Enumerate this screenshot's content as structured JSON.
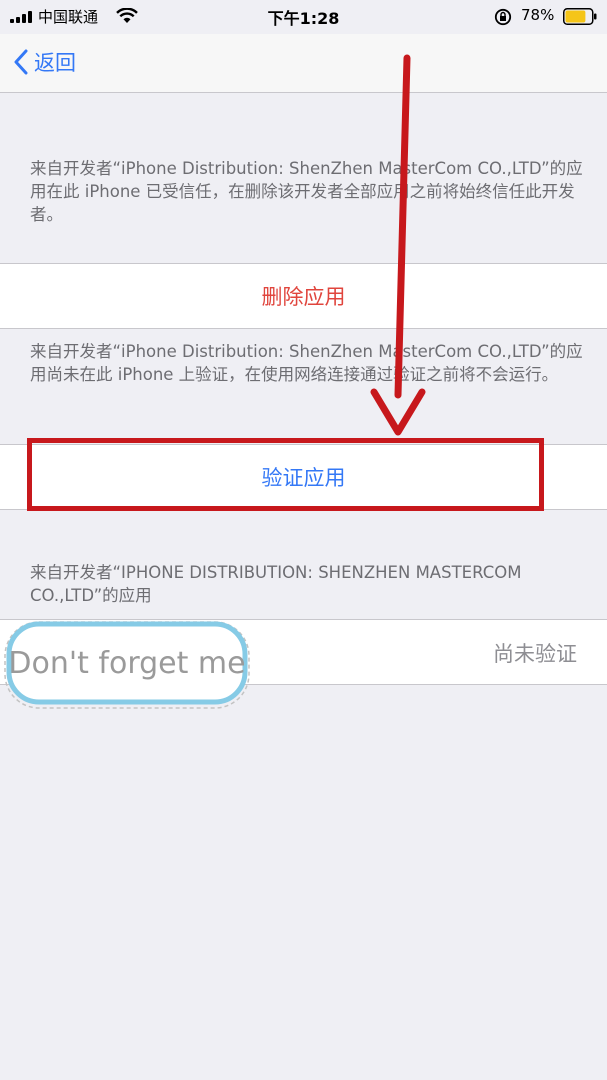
{
  "status_bar": {
    "carrier": "中国联通",
    "time": "下午1:28",
    "battery_percent": "78%",
    "battery_level": 0.78,
    "icons": [
      "signal-icon",
      "wifi-icon",
      "rotation-lock-icon",
      "battery-icon"
    ]
  },
  "nav": {
    "back_label": "返回"
  },
  "sections": {
    "trusted_description": "来自开发者“iPhone Distribution: ShenZhen MasterCom CO.,LTD”的应用在此 iPhone 已受信任，在删除该开发者全部应用之前将始终信任此开发者。",
    "delete_label": "删除应用",
    "unverified_description": "来自开发者“iPhone Distribution: ShenZhen MasterCom CO.,LTD”的应用尚未在此 iPhone 上验证，在使用网络连接通过验证之前将不会运行。",
    "verify_label": "验证应用",
    "apps_header": "来自开发者“IPHONE DISTRIBUTION: SHENZHEN MASTERCOM CO.,LTD”的应用",
    "app_status": "尚未验证"
  },
  "watermark": {
    "text": "Don't forget me"
  },
  "colors": {
    "accent_blue": "#3478f6",
    "destructive_red": "#e0453d",
    "annotation_red": "#c7181c",
    "background": "#efeff4"
  }
}
